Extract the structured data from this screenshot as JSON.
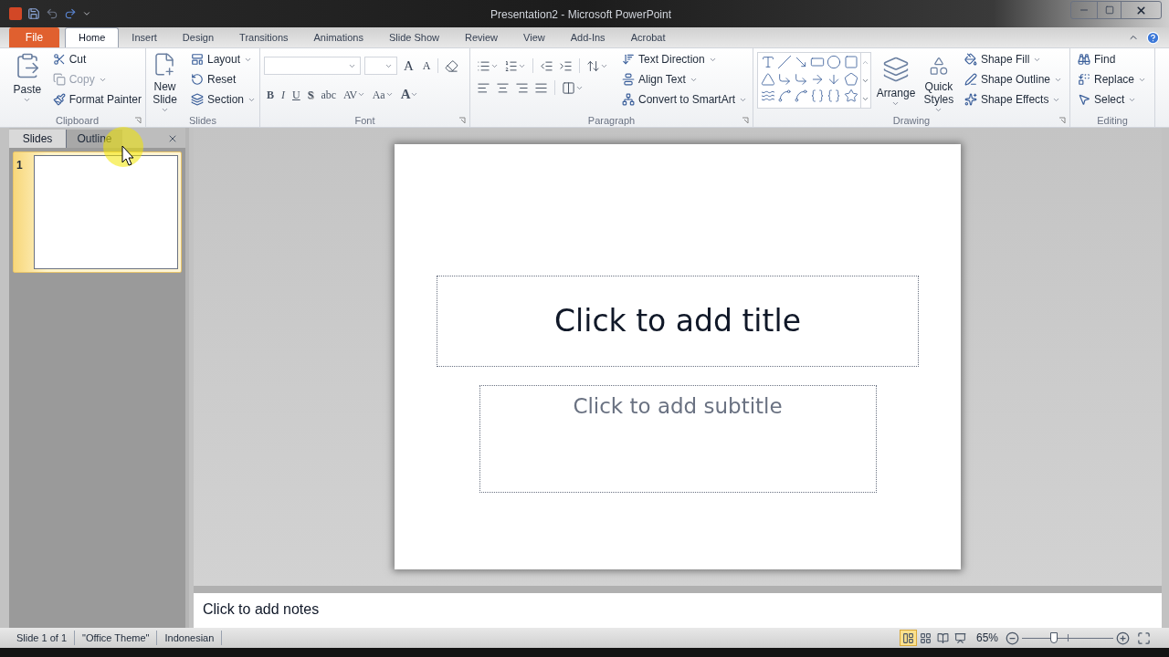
{
  "window": {
    "title": "Presentation2 - Microsoft PowerPoint"
  },
  "tabs": [
    {
      "label": "File",
      "kind": "file",
      "selected": false
    },
    {
      "label": "Home",
      "kind": "tab",
      "selected": true
    },
    {
      "label": "Insert",
      "kind": "tab",
      "selected": false
    },
    {
      "label": "Design",
      "kind": "tab",
      "selected": false
    },
    {
      "label": "Transitions",
      "kind": "tab",
      "selected": false
    },
    {
      "label": "Animations",
      "kind": "tab",
      "selected": false
    },
    {
      "label": "Slide Show",
      "kind": "tab",
      "selected": false
    },
    {
      "label": "Review",
      "kind": "tab",
      "selected": false
    },
    {
      "label": "View",
      "kind": "tab",
      "selected": false
    },
    {
      "label": "Add-Ins",
      "kind": "tab",
      "selected": false
    },
    {
      "label": "Acrobat",
      "kind": "tab",
      "selected": false
    }
  ],
  "ribbon": [
    {
      "kind": "clipboard",
      "name": "Clipboard",
      "launcher": true,
      "large": [
        {
          "label": "Paste",
          "dropdown": true
        }
      ],
      "small": [
        {
          "label": "Cut",
          "dropdown": false,
          "disabled": false
        },
        {
          "label": "Copy",
          "dropdown": true,
          "disabled": true
        },
        {
          "label": "Format Painter",
          "dropdown": false,
          "disabled": false
        }
      ]
    },
    {
      "kind": "slides",
      "name": "Slides",
      "launcher": false,
      "large": [
        {
          "label": "New Slide",
          "dropdown": true
        }
      ],
      "small": [
        {
          "label": "Layout",
          "dropdown": true,
          "disabled": false
        },
        {
          "label": "Reset",
          "dropdown": false,
          "disabled": false
        },
        {
          "label": "Section",
          "dropdown": true,
          "disabled": false
        }
      ]
    },
    {
      "kind": "font",
      "name": "Font",
      "launcher": true,
      "glyphs_top": [
        {
          "text": "A",
          "dropdown": false
        },
        {
          "text": "A",
          "dropdown": false
        }
      ],
      "glyphs_bottom": [
        {
          "text": "B",
          "dropdown": false
        },
        {
          "text": "I",
          "dropdown": false
        },
        {
          "text": "U",
          "dropdown": false
        },
        {
          "text": "S",
          "dropdown": false
        },
        {
          "text": "abc",
          "dropdown": false
        },
        {
          "text": "AV",
          "dropdown": true
        },
        {
          "text": "Aa",
          "dropdown": true
        },
        {
          "text": "A",
          "dropdown": true
        }
      ]
    },
    {
      "kind": "paragraph",
      "name": "Paragraph",
      "launcher": true,
      "small": [
        {
          "label": "Text Direction",
          "dropdown": true,
          "disabled": false
        },
        {
          "label": "Align Text",
          "dropdown": true,
          "disabled": false
        },
        {
          "label": "Convert to SmartArt",
          "dropdown": true,
          "disabled": false
        }
      ]
    },
    {
      "kind": "drawing",
      "name": "Drawing",
      "launcher": true,
      "large": [
        {
          "label": "Arrange",
          "dropdown": true
        },
        {
          "label": "Quick Styles",
          "dropdown": true
        }
      ],
      "small": [
        {
          "label": "Shape Fill",
          "dropdown": true,
          "disabled": false
        },
        {
          "label": "Shape Outline",
          "dropdown": true,
          "disabled": false
        },
        {
          "label": "Shape Effects",
          "dropdown": true,
          "disabled": false
        }
      ]
    },
    {
      "kind": "editing",
      "name": "Editing",
      "launcher": false,
      "small": [
        {
          "label": "Find",
          "dropdown": false,
          "disabled": false
        },
        {
          "label": "Replace",
          "dropdown": true,
          "disabled": false
        },
        {
          "label": "Select",
          "dropdown": true,
          "disabled": false
        }
      ]
    }
  ],
  "left_pane": {
    "tabs": [
      {
        "label": "Slides",
        "selected": true
      },
      {
        "label": "Outline",
        "selected": false
      }
    ],
    "thumbnails": [
      {
        "number": "1",
        "selected": true
      }
    ]
  },
  "slide": {
    "title_placeholder": "Click to add title",
    "subtitle_placeholder": "Click to add subtitle"
  },
  "notes": {
    "placeholder": "Click to add notes"
  },
  "status_bar": {
    "items": [
      "Slide 1 of 1",
      "\"Office Theme\"",
      "Indonesian"
    ],
    "views": [
      {
        "selected": true
      },
      {
        "selected": false
      },
      {
        "selected": false
      },
      {
        "selected": false
      }
    ],
    "zoom": "65%",
    "zoom_slider": {
      "level": 0.35
    }
  }
}
